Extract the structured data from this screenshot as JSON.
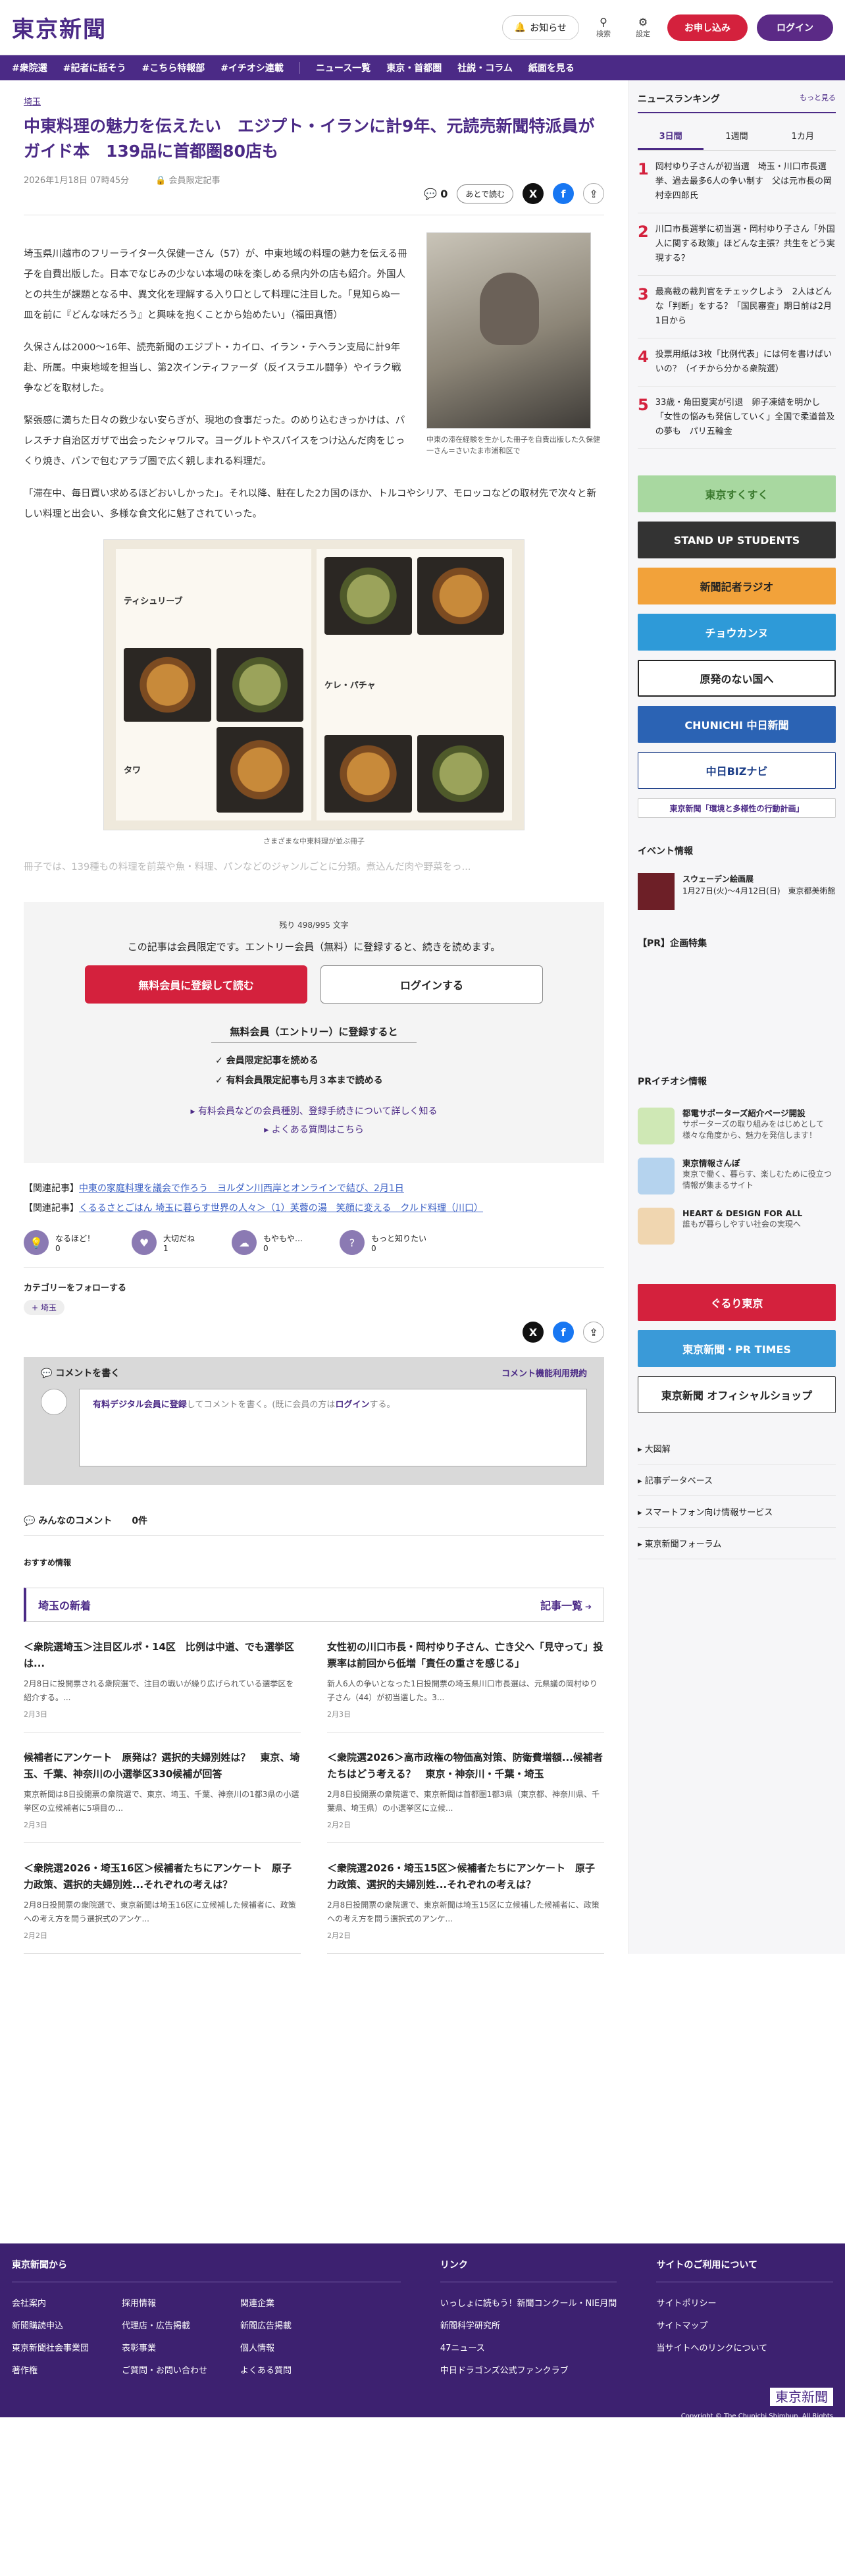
{
  "header": {
    "logo": "東京新聞",
    "notice": "お知らせ",
    "search": "検索",
    "settings": "設定",
    "register": "お申し込み",
    "login": "ログイン"
  },
  "nav": [
    "#衆院選",
    "#記者に話そう",
    "#こちら特報部",
    "#イチオシ連載",
    "ニュース一覧",
    "東京・首都圏",
    "社説・コラム",
    "紙面を見る"
  ],
  "article": {
    "tag": "埼玉",
    "title": "中東料理の魅力を伝えたい　エジプト・イランに計9年、元読売新聞特派員がガイド本　139品に首都圏80店も",
    "date": "2026年1月18日 07時45分",
    "member": "会員限定記事",
    "count": "0",
    "later": "あとで読む",
    "p1": "埼玉県川越市のフリーライター久保健一さん（57）が、中東地域の料理の魅力を伝える冊子を自費出版した。日本でなじみの少ない本場の味を楽しめる県内外の店も紹介。外国人との共生が課題となる中、異文化を理解する入り口として料理に注目した。「見知らぬ一皿を前に『どんな味だろう』と興味を抱くことから始めたい」（福田真悟）",
    "p2": "久保さんは2000～16年、読売新聞のエジプト・カイロ、イラン・テヘラン支局に計9年赴、所属。中東地域を担当し、第2次インティファーダ（反イスラエル闘争）やイラク戦争などを取材した。",
    "p3": "緊張感に満ちた日々の数少ない安らぎが、現地の食事だった。のめり込むきっかけは、パレスチナ自治区ガザで出会ったシャワルマ。ヨーグルトやスパイスをつけ込んだ肉をじっくり焼き、パンで包むアラブ圏で広く親しまれる料理だ。",
    "p4": "「滞在中、毎日買い求めるほどおいしかった」。それ以降、駐在した2カ国のほか、トルコやシリア、モロッコなどの取材先で次々と新しい料理と出会い、多様な食文化に魅了されていった。",
    "photo1_cap": "中東の滞在経験を生かした冊子を自費出版した久保健一さん＝さいたま市浦和区で",
    "book_labels": [
      "ティシュリーブ",
      "ケレ・パチャ",
      "タワ"
    ],
    "photo2_cap": "さまざまな中東料理が並ぶ冊子",
    "fade": "冊子では、139種もの料理を前菜や魚・料理、パンなどのジャンルごとに分類。煮込んだ肉や野菜をっ..."
  },
  "paywall": {
    "remain": "残り 498/995 文字",
    "msg": "この記事は会員限定です。エントリー会員（無料）に登録すると、続きを読めます。",
    "btn1": "無料会員に登録して読む",
    "btn2": "ログインする",
    "heading": "無料会員（エントリー）に登録すると",
    "b1": "会員限定記事を読める",
    "b2": "有料会員限定記事も月３本まで読める",
    "link1": "有料会員などの会員種別、登録手続きについて詳しく知る",
    "link2": "よくある質問はこちら"
  },
  "related": [
    {
      "pre": "【関連記事】",
      "text": "中東の家庭料理を議会で作ろう　ヨルダン川西岸とオンラインで結び、2月1日"
    },
    {
      "pre": "【関連記事】",
      "text": "くるるさとごはん 埼玉に暮らす世界の人々＞（1）芙蓉の湯　笑顔に変える　クルド料理（川口）"
    }
  ],
  "reactions": [
    {
      "label": "なるほど！",
      "count": "0"
    },
    {
      "label": "大切だね",
      "count": "1"
    },
    {
      "label": "もやもや…",
      "count": "0"
    },
    {
      "label": "もっと知りたい",
      "count": "0"
    }
  ],
  "category": {
    "heading": "カテゴリーをフォローする",
    "tag": "埼玉"
  },
  "comment": {
    "title": "コメントを書く",
    "rules": "コメント機能利用規約",
    "ph1": "有料デジタル会員に登録",
    "ph2": "してコメントを書く。(既に会員の方は",
    "ph3": "ログイン",
    "ph4": "する。",
    "all": "みんなのコメント",
    "cnt": "0件"
  },
  "recommend": "おすすめ情報",
  "region": {
    "title": "埼玉の新着",
    "more": "記事一覧"
  },
  "cards": [
    {
      "t": "＜衆院選埼玉＞注目区ルポ・14区　比例は中道、でも選挙区は...",
      "p": "2月8日に投開票される衆院選で、注目の戦いが繰り広げられている選挙区を紹介する。...",
      "d": "2月3日"
    },
    {
      "t": "女性初の川口市長・岡村ゆり子さん、亡き父へ「見守って」投票率は前回から低増「責任の重さを感じる」",
      "p": "新人6人の争いとなった1日投開票の埼玉県川口市長選は、元県議の岡村ゆり子さん（44）が初当選した。3...",
      "d": "2月3日"
    },
    {
      "t": "候補者にアンケート　原発は？選択的夫婦別姓は？　東京、埼玉、千葉、神奈川の小選挙区330候補が回答",
      "p": "東京新聞は8日投開票の衆院選で、東京、埼玉、千葉、神奈川の1都3県の小選挙区の立候補者に5項目の...",
      "d": "2月3日"
    },
    {
      "t": "＜衆院選2026＞高市政権の物価高対策、防衛費増額...候補者たちはどう考える？　東京・神奈川・千葉・埼玉",
      "p": "2月8日投開票の衆院選で、東京新聞は首都圏1都3県（東京都、神奈川県、千葉県、埼玉県）の小選挙区に立候...",
      "d": "2月2日"
    },
    {
      "t": "＜衆院選2026・埼玉16区＞候補者たちにアンケート　原子力政策、選択的夫婦別姓...それぞれの考えは？",
      "p": "2月8日投開票の衆院選で、東京新聞は埼玉16区に立候補した候補者に、政策への考え方を問う選択式のアンケ...",
      "d": "2月2日"
    },
    {
      "t": "＜衆院選2026・埼玉15区＞候補者たちにアンケート　原子力政策、選択的夫婦別姓...それぞれの考えは？",
      "p": "2月8日投開票の衆院選で、東京新聞は埼玉15区に立候補した候補者に、政策への考え方を問う選択式のアンケ...",
      "d": "2月2日"
    }
  ],
  "ranking": {
    "title": "ニュースランキング",
    "more": "もっと見る",
    "tabs": [
      "3日間",
      "1週間",
      "1カ月"
    ],
    "items": [
      "岡村ゆり子さんが初当選　埼玉・川口市長選挙、過去最多6人の争い制す　父は元市長の岡村幸四郎氏",
      "川口市長選挙に初当選・岡村ゆり子さん「外国人に関する政策」ほどんな主張？共生をどう実現する？",
      "最高裁の裁判官をチェックしよう　2人はどんな「判断」をする？「国民審査」期日前は2月1日から",
      "投票用紙は3枚「比例代表」には何を書けばいいの？（イチから分かる衆院選）",
      "33歳・角田夏実が引退　卵子凍結を明かし「女性の悩みも発信していく」全国で柔道普及の夢も　パリ五輪金"
    ]
  },
  "banners": [
    "東京すくすく",
    "STAND UP STUDENTS",
    "新聞記者ラジオ",
    "チョウカンヌ",
    "原発のない国へ",
    "CHUNICHI 中日新聞",
    "中日BIZナビ",
    "東京新聞「環境と多様性の行動計画」"
  ],
  "events": {
    "title": "イベント情報",
    "name": "スウェーデン絵画展",
    "desc": "1月27日(火)～4月12日(日)　東京都美術館"
  },
  "pr_plan": "【PR】企画特集",
  "pr_info": {
    "title": "PRイチオシ情報",
    "items": [
      {
        "t": "都電サポーターズ紹介ページ開設",
        "d": "サポーターズの取り組みをはじめとして様々な角度から、魅力を発信します！"
      },
      {
        "t": "東京情報さんぽ",
        "d": "東京で働く、暮らす、楽しむために役立つ情報が集まるサイト"
      },
      {
        "t": "HEART & DESIGN FOR ALL",
        "d": "誰もが暮らしやすい社会の実現へ"
      }
    ]
  },
  "side_banners": [
    "ぐるり東京",
    "東京新聞・PR TIMES",
    "東京新聞 オフィシャルショップ"
  ],
  "side_links": [
    "大図解",
    "記事データベース",
    "スマートフォン向け情報サービス",
    "東京新聞フォーラム"
  ],
  "footer": {
    "c1": "東京新聞から",
    "c1a": [
      "会社案内",
      "新聞購読申込",
      "東京新聞社会事業団",
      "著作権"
    ],
    "c1b": [
      "採用情報",
      "代理店・広告掲載",
      "表彰事業",
      "ご質問・お問い合わせ"
    ],
    "c1c": [
      "関連企業",
      "新聞広告掲載",
      "個人情報",
      "よくある質問"
    ],
    "c2": "リンク",
    "c2a": [
      "いっしょに読もう！新聞コンクール・NIE月間",
      "新聞科学研究所",
      "47ニュース",
      "中日ドラゴンズ公式ファンクラブ"
    ],
    "c3": "サイトのご利用について",
    "c3a": [
      "サイトポリシー",
      "サイトマップ",
      "当サイトへのリンクについて"
    ],
    "copy": "Copyright © The Chunichi Shimbun, All Rights Reserved."
  }
}
